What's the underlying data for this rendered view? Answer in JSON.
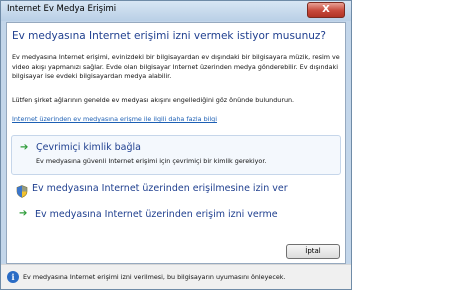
{
  "window": {
    "title": "Internet Ev Medya Erişimi",
    "close_label": "X"
  },
  "main": {
    "question": "Ev medyasına Internet erişimi izni vermek istiyor musunuz?",
    "description": "Ev medyasına Internet erişimi, evinizdeki bir bilgisayardan ev dışındaki bir bilgisayara müzik, resim ve video akışı yapmanızı sağlar. Evde olan bilgisayar Internet üzerinden medya gönderebilir. Ev dışındaki bilgisayar ise evdeki bilgisayardan medya alabilir.",
    "hint": "Lütfen şirket ağlarının genelde ev medyası akışını engellediğini göz önünde bulundurun.",
    "link": "Internet üzerinden ev medyasına erişme ile ilgili daha fazla bilgi"
  },
  "options": {
    "online_id": {
      "label": "Çevrimiçi kimlik bağla",
      "sublabel": "Ev medyasına güvenli Internet erişimi için çevrimiçi bir kimlik gerekiyor.",
      "icon": "green-arrow-icon"
    },
    "allow": {
      "label": "Ev medyasına Internet üzerinden erişilmesine izin ver",
      "icon": "shield-icon"
    },
    "deny": {
      "label": "Ev medyasına Internet üzerinden erişim izni verme",
      "icon": "green-arrow-icon"
    }
  },
  "buttons": {
    "cancel": "İptal"
  },
  "footer": {
    "text": "Ev medyasına Internet erişimi izni verilmesi, bu bilgisayarın uyumasını önleyecek.",
    "icon": "info-icon"
  },
  "colors": {
    "heading": "#1f3f8f",
    "link": "#1c5fb4",
    "arrow": "#2e9c3a",
    "close": "#c7483a"
  }
}
